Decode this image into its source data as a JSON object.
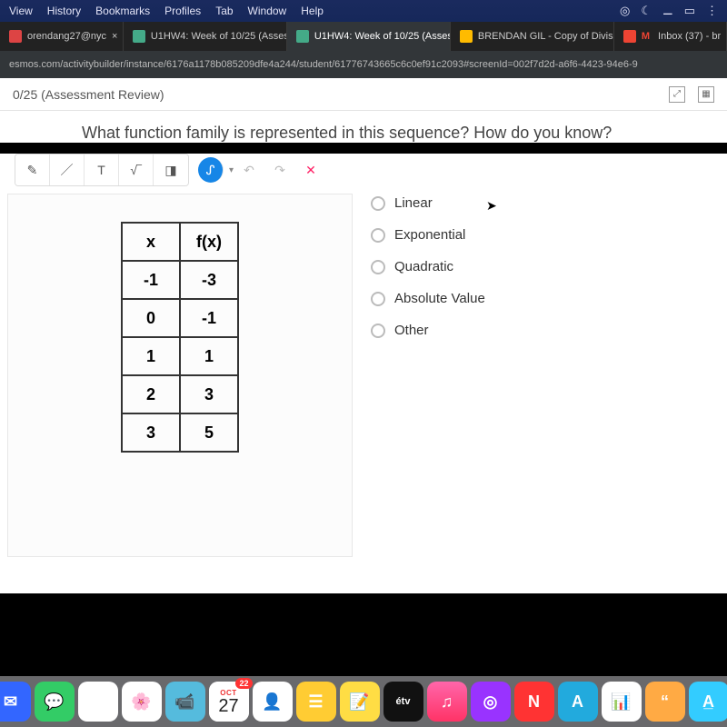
{
  "menubar": {
    "items": [
      "View",
      "History",
      "Bookmarks",
      "Profiles",
      "Tab",
      "Window",
      "Help"
    ]
  },
  "tabs": [
    {
      "label": "orendang27@nyc",
      "active": false
    },
    {
      "label": "U1HW4: Week of 10/25 (Asses",
      "active": false
    },
    {
      "label": "U1HW4: Week of 10/25 (Asses",
      "active": true
    },
    {
      "label": "BRENDAN GIL - Copy of Divis",
      "active": false
    },
    {
      "label": "Inbox (37) - br",
      "active": false
    }
  ],
  "url": "esmos.com/activitybuilder/instance/6176a1178b085209dfe4a244/student/61776743665c6c0ef91c2093#screenId=002f7d2d-a6f6-4423-94e6-9",
  "page_title": "0/25 (Assessment Review)",
  "question": "What function family is represented in this sequence? How do you know?",
  "toolbar": {
    "pencil": "✎",
    "line": "／",
    "text": "T",
    "math": "√‾",
    "erase": "◨",
    "ink": "ᔑ",
    "caret": "▾",
    "undo": "↶",
    "redo": "↷",
    "close": "✕"
  },
  "table": {
    "headers": [
      "x",
      "f(x)"
    ],
    "rows": [
      [
        "-1",
        "-3"
      ],
      [
        "0",
        "-1"
      ],
      [
        "1",
        "1"
      ],
      [
        "2",
        "3"
      ],
      [
        "3",
        "5"
      ]
    ]
  },
  "options": [
    "Linear",
    "Exponential",
    "Quadratic",
    "Absolute Value",
    "Other"
  ],
  "dock": {
    "date": {
      "mon": "OCT",
      "day": "27"
    },
    "calendar_badge": "22",
    "tv_label": "étv"
  }
}
